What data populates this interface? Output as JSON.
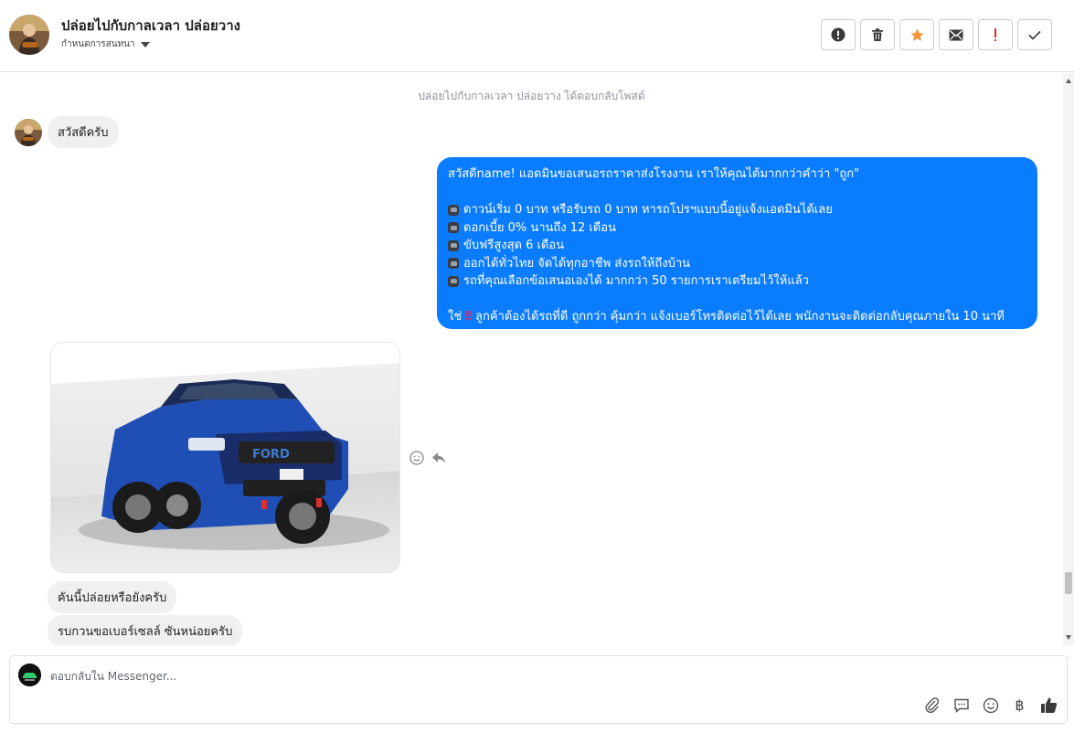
{
  "header": {
    "title": "ปล่อยไปกับกาลเวลา ปล่อยวาง",
    "subtitle": "กำหนดการสนทนา"
  },
  "conversation": {
    "notice": "ปล่อยไปกับกาลเวลา ปล่อยวาง ได้ตอบกลับโพสต์",
    "greeting_in": "สวัสดีครับ",
    "reply_out": {
      "line1": "สวัสดีname! แอดมินขอเสนอรถราคาส่งโรงงาน เราให้คุณได้มากกว่าคำว่า \"ถูก\"",
      "bullets": [
        "ดาวน์เริ่ม 0 บาท หรือรับรถ 0 บาท หารถโปรฯแบบนี้อยู่แจ้งแอดมินได้เลย",
        "ดอกเบี้ย 0% นานถึง 12 เดือน",
        "ขับฟรีสูงสุด 6 เดือน",
        "ออกได้ทั่วไทย จัดได้ทุกอาชีพ ส่งรถให้ถึงบ้าน",
        "รถที่คุณเลือกข้อเสนอเองได้ มากกว่า 50 รายการเราเตรียมไว้ให้แล้ว"
      ],
      "closing_prefix": "ใช่",
      "closing": "ลูกค้าต้องได้รถที่ดี ถูกกว่า คุ้มกว่า แจ้งเบอร์โทรติดต่อไว้ได้เลย พนักงานจะติดต่อกลับคุณภายใน 10 นาที"
    },
    "photo_grille_text": "FORD",
    "question1": "คันนี้ปล่อยหรือยังครับ",
    "question2": "รบกวนขอเบอร์เซลล์ ซันหน่อยครับ"
  },
  "composer": {
    "placeholder": "ตอบกลับใน Messenger..."
  },
  "colors": {
    "outgoing_bubble": "#0a7cff",
    "incoming_bubble": "#f0f0f0",
    "star": "#f7923a",
    "alert": "#e02424"
  }
}
